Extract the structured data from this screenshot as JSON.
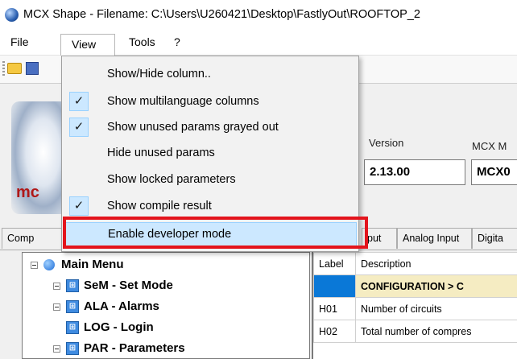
{
  "window": {
    "title": "MCX Shape  -  Filename: C:\\Users\\U260421\\Desktop\\FastlyOut\\ROOFTOP_2"
  },
  "menubar": {
    "items": [
      "File",
      "View",
      "Tools",
      "?"
    ]
  },
  "header": {
    "version_label": "Version",
    "version_value": "2.13.00",
    "mcx_label": "MCX M",
    "mcx_value": "MCX0",
    "logo_text": "mc"
  },
  "view_menu": {
    "items": [
      {
        "label": "Show/Hide column..",
        "checked": false
      },
      {
        "label": "Show multilanguage columns",
        "checked": true
      },
      {
        "label": "Show unused params grayed out",
        "checked": true
      },
      {
        "label": "Hide unused params",
        "checked": false
      },
      {
        "label": "Show locked parameters",
        "checked": false
      },
      {
        "label": "Show compile result",
        "checked": true
      },
      {
        "label": "Enable developer mode",
        "checked": false,
        "highlighted": true
      }
    ],
    "check_glyph": "✓"
  },
  "tabs": [
    "Comp",
    "put",
    "Analog Input",
    "Digita"
  ],
  "tree": {
    "root": "Main Menu",
    "nodes": [
      "SeM - Set Mode",
      "ALA - Alarms",
      "LOG - Login",
      "PAR - Parameters"
    ]
  },
  "grid": {
    "headers": [
      "Label",
      "Description"
    ],
    "rows": [
      {
        "label": "",
        "description": "CONFIGURATION > C"
      },
      {
        "label": "H01",
        "description": "Number of circuits"
      },
      {
        "label": "H02",
        "description": "Total number of compres"
      }
    ]
  },
  "colors": {
    "accent": "#0a78d7",
    "highlight_box": "#e3141c",
    "check_bg": "#cce8ff",
    "config_row": "#f5ecc2"
  }
}
